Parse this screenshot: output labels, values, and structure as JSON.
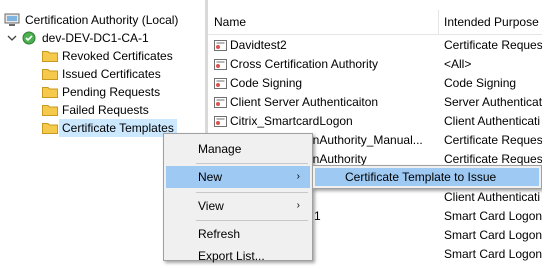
{
  "tree": {
    "root_label": "Certification Authority (Local)",
    "ca_label": "dev-DEV-DC1-CA-1",
    "folders": [
      "Revoked Certificates",
      "Issued Certificates",
      "Pending Requests",
      "Failed Requests",
      "Certificate Templates"
    ],
    "selected_folder": "Certificate Templates"
  },
  "list": {
    "columns": {
      "name": "Name",
      "purpose": "Intended Purpose"
    },
    "rows": [
      {
        "name": "Davidtest2",
        "purpose": "Certificate Request"
      },
      {
        "name": "Cross Certification Authority",
        "purpose": "<All>"
      },
      {
        "name": "Code Signing",
        "purpose": "Code Signing"
      },
      {
        "name": "Client Server Authenticaiton",
        "purpose": "Server Authenticat"
      },
      {
        "name": "Citrix_SmartcardLogon",
        "purpose": "Client Authenticati"
      },
      {
        "name": "onAuthority_Manual...",
        "purpose": "Certificate Request"
      },
      {
        "name": "onAuthority",
        "purpose": "Certificate Request"
      },
      {
        "name": "",
        "purpose": ""
      },
      {
        "name": "",
        "purpose": "Client Authenticati"
      },
      {
        "name": "1",
        "purpose": "Smart Card Logon,"
      },
      {
        "name": "",
        "purpose": "Smart Card Logon,"
      },
      {
        "name": "",
        "purpose": "Smart Card Logon,"
      },
      {
        "name": "",
        "purpose": "Smart Card Logon,"
      }
    ]
  },
  "context_menu": {
    "items": [
      "Manage",
      "New",
      "View",
      "Refresh",
      "Export List..."
    ],
    "highlighted": "New",
    "submenu_arrow": "›"
  },
  "submenu": {
    "item": "Certificate Template to Issue"
  },
  "colors": {
    "selection": "#cce8ff",
    "menu_highlight": "#9ec9f2",
    "menu_bg": "#f0f0f0"
  }
}
